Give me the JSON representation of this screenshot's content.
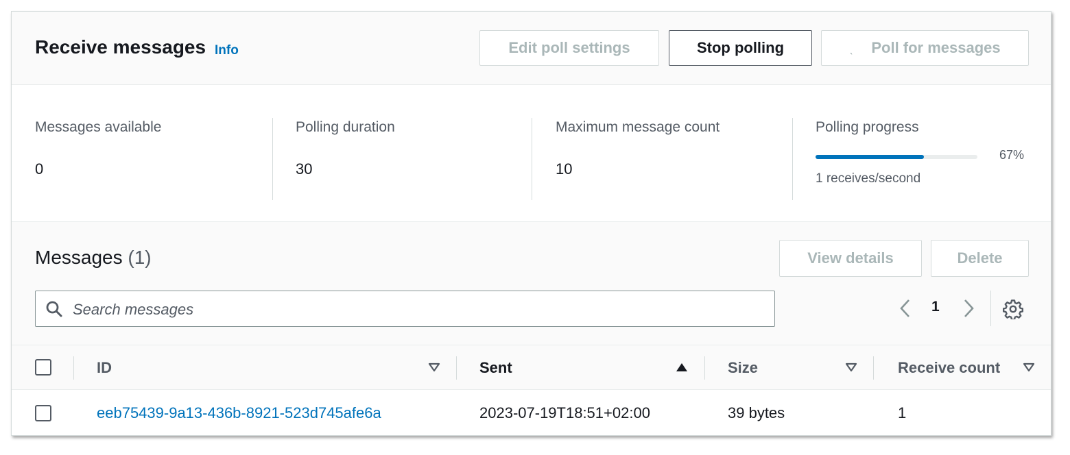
{
  "header": {
    "title": "Receive messages",
    "info_label": "Info",
    "buttons": {
      "edit_poll_settings": "Edit poll settings",
      "stop_polling": "Stop polling",
      "poll_for_messages": "Poll for messages"
    }
  },
  "stats": {
    "messages_available": {
      "label": "Messages available",
      "value": "0"
    },
    "polling_duration": {
      "label": "Polling duration",
      "value": "30"
    },
    "maximum_message_count": {
      "label": "Maximum message count",
      "value": "10"
    },
    "polling_progress": {
      "label": "Polling progress",
      "percent_label": "67%",
      "percent": 67,
      "rate": "1 receives/second"
    }
  },
  "messages": {
    "title": "Messages",
    "count": "(1)",
    "buttons": {
      "view_details": "View details",
      "delete": "Delete"
    },
    "search": {
      "placeholder": "Search messages",
      "value": ""
    },
    "pagination": {
      "current_page": "1"
    },
    "columns": [
      {
        "label": "ID",
        "sort": "none"
      },
      {
        "label": "Sent",
        "sort": "ascending"
      },
      {
        "label": "Size",
        "sort": "none"
      },
      {
        "label": "Receive count",
        "sort": "none"
      }
    ],
    "rows": [
      {
        "id": "eeb75439-9a13-436b-8921-523d745afe6a",
        "sent": "2023-07-19T18:51+02:00",
        "size": "39 bytes",
        "receive_count": "1"
      }
    ]
  },
  "icons": {
    "search": "search-icon",
    "prev": "chevron-left-icon",
    "next": "chevron-right-icon",
    "settings": "gear-icon",
    "sort_none": "caret-down-outline-icon",
    "sort_asc": "caret-up-filled-icon",
    "loading": "spinner-icon"
  },
  "colors": {
    "link": "#0073bb",
    "progress": "#0073bb",
    "disabled_text": "#aab7b8"
  }
}
